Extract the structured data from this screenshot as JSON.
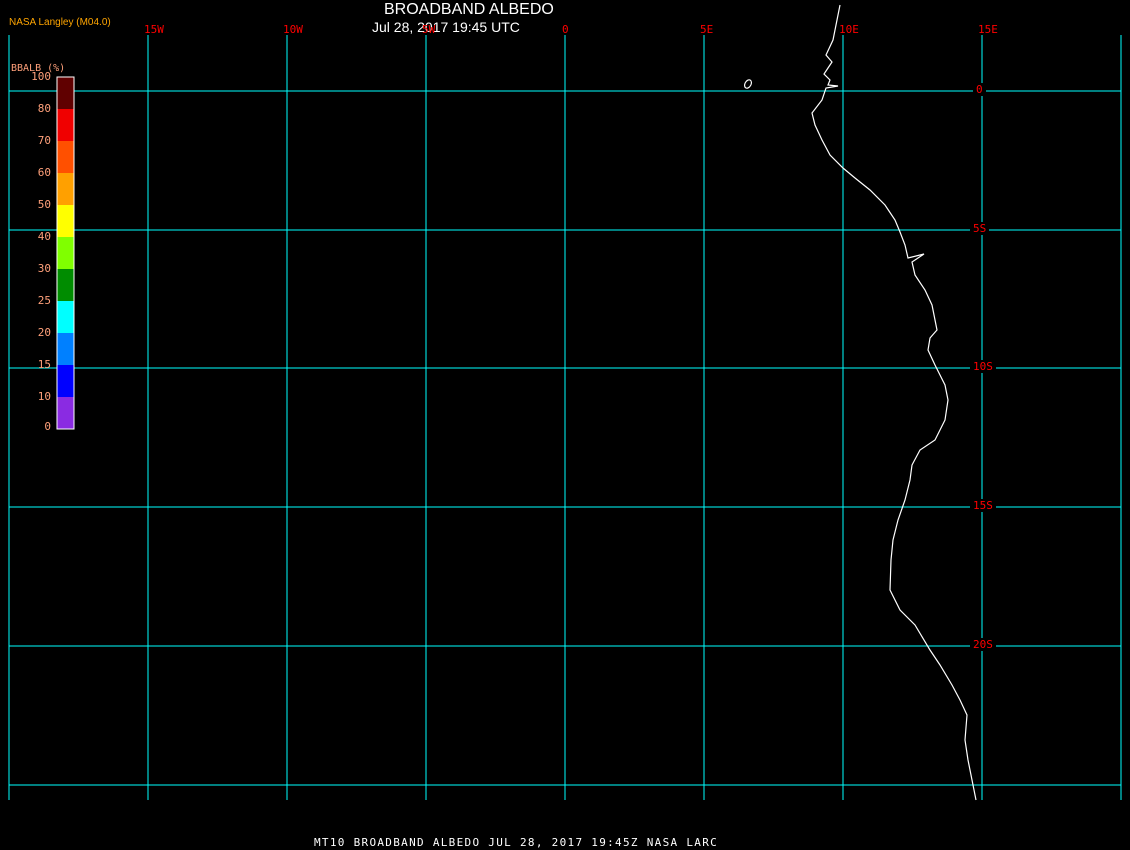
{
  "header": {
    "title": "BROADBAND ALBEDO",
    "subtitle": "Jul 28, 2017 19:45 UTC",
    "credit": "NASA Langley (M04.0)"
  },
  "colorbar": {
    "label": "BBALB (%)",
    "ticks": [
      "100",
      "80",
      "70",
      "60",
      "50",
      "40",
      "30",
      "25",
      "20",
      "15",
      "10",
      "0"
    ],
    "colors": [
      "#600000",
      "#f00000",
      "#ff5000",
      "#ffa000",
      "#ffff00",
      "#80ff00",
      "#008c00",
      "#00ffff",
      "#0080ff",
      "#0000ff",
      "#8a2be2"
    ]
  },
  "map": {
    "grid_color": "#00ffff",
    "label_color": "#ff0000",
    "coastline_color": "#ffffff",
    "longitude_labels": [
      "15W",
      "10W",
      "5W",
      "0",
      "5E",
      "10E",
      "15E"
    ],
    "latitude_labels": [
      "0",
      "5S",
      "10S",
      "15S",
      "20S"
    ]
  },
  "footer": {
    "text": "MT10  BROADBAND ALBEDO   JUL 28, 2017 19:45Z   NASA LARC"
  }
}
